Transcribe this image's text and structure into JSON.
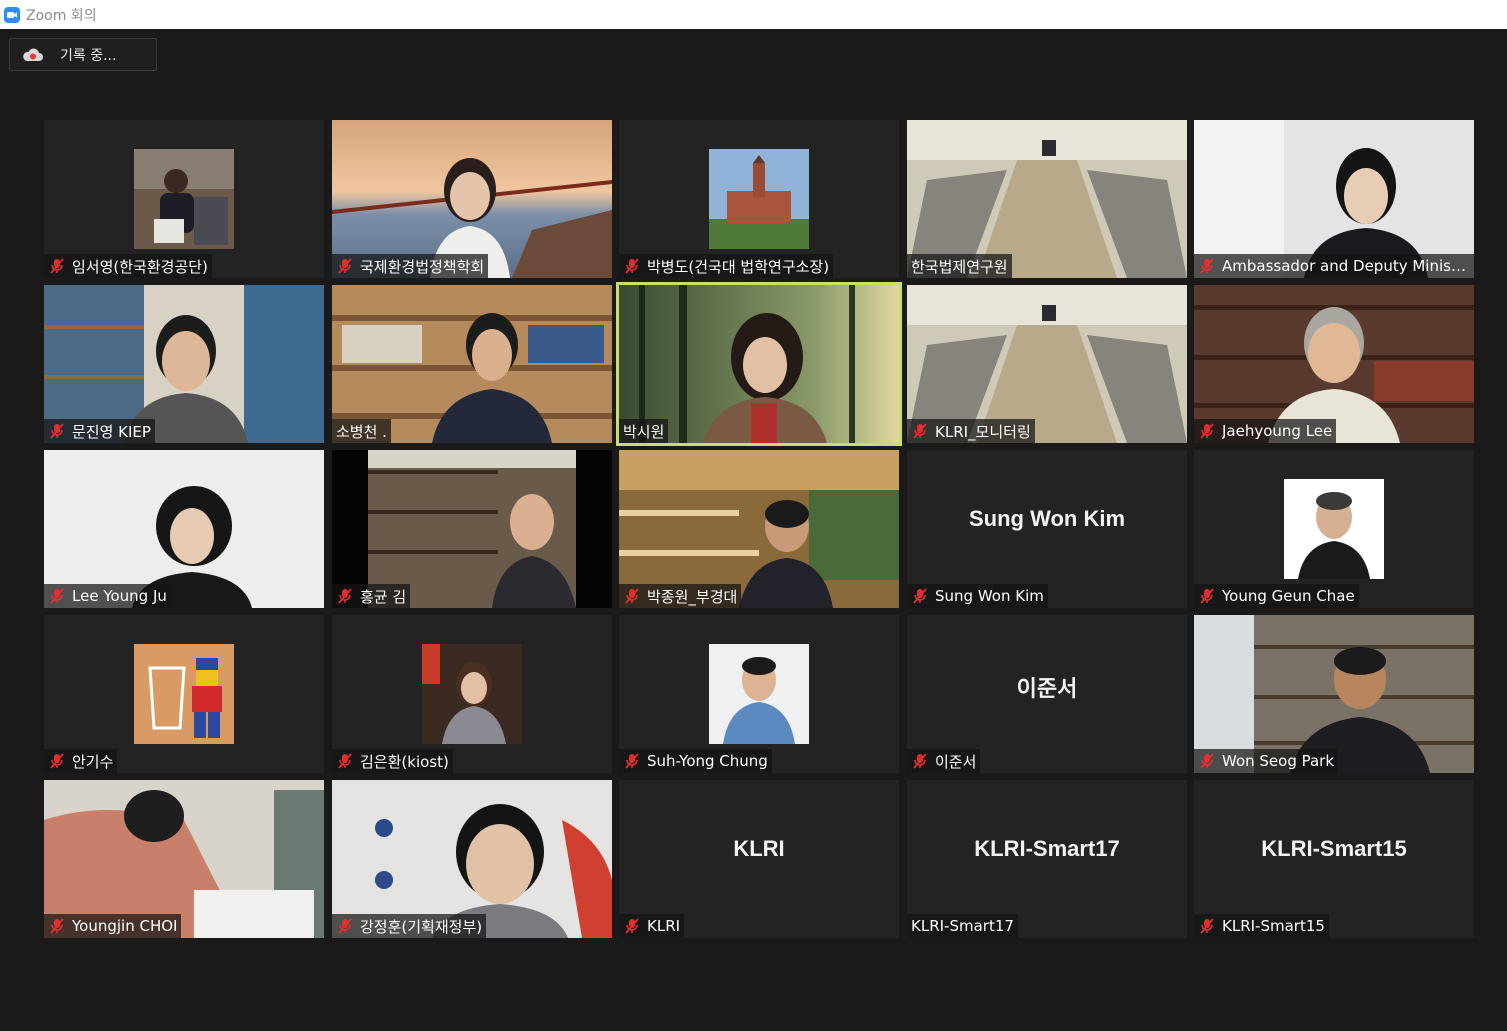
{
  "window": {
    "title": "Zoom 회의"
  },
  "recording": {
    "label": "기록 중..."
  },
  "colors": {
    "accent": "#2D8CFF",
    "mute_red": "#e02f2f",
    "active_speaker": "#c8e06a",
    "tile_bg": "#232323"
  },
  "participants": [
    {
      "name": "임서영(한국환경공단)",
      "muted": true
    },
    {
      "name": "국제환경법정책학회",
      "muted": true
    },
    {
      "name": "박병도(건국대 법학연구소장)",
      "muted": true
    },
    {
      "name": "한국법제연구원",
      "muted": false
    },
    {
      "name": "Ambassador and Deputy Minister ...",
      "muted": true
    },
    {
      "name": "문진영 KIEP",
      "muted": true
    },
    {
      "name": "소병천 .",
      "muted": false
    },
    {
      "name": "박시원",
      "muted": false,
      "active": true
    },
    {
      "name": "KLRI_모니터링",
      "muted": true
    },
    {
      "name": "Jaehyoung Lee",
      "muted": true
    },
    {
      "name": "Lee Young Ju",
      "muted": true
    },
    {
      "name": "홍균 김",
      "muted": true
    },
    {
      "name": "박종원_부경대",
      "muted": true
    },
    {
      "name": "Sung Won Kim",
      "muted": true,
      "display_name": "Sung Won Kim"
    },
    {
      "name": "Young Geun Chae",
      "muted": true
    },
    {
      "name": "안기수",
      "muted": true
    },
    {
      "name": "김은환(kiost)",
      "muted": true
    },
    {
      "name": "Suh-Yong Chung",
      "muted": true
    },
    {
      "name": "이준서",
      "muted": true,
      "display_name": "이준서"
    },
    {
      "name": "Won Seog Park",
      "muted": true
    },
    {
      "name": "Youngjin CHOI",
      "muted": true
    },
    {
      "name": "강정훈(기획재정부)",
      "muted": true
    },
    {
      "name": "KLRI",
      "muted": true,
      "display_name": "KLRI"
    },
    {
      "name": "KLRI-Smart17",
      "muted": false,
      "display_name": "KLRI-Smart17"
    },
    {
      "name": "KLRI-Smart15",
      "muted": true,
      "display_name": "KLRI-Smart15"
    }
  ]
}
